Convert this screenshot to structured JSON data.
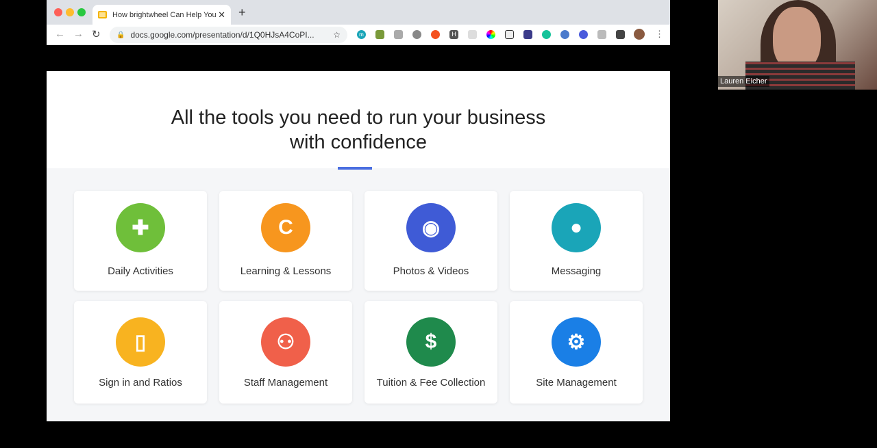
{
  "browser": {
    "tab_title": "How brightwheel Can Help You",
    "url": "docs.google.com/presentation/d/1Q0HJsA4CoPI...",
    "extension_letter_m": "m",
    "extension_letter_h": "H"
  },
  "slide": {
    "title_line1": "All the tools you need to run your business",
    "title_line2": "with confidence",
    "accent": "#4a6ee0",
    "cards": [
      {
        "label": "Daily Activities",
        "icon": "puzzle-icon",
        "color": "#6fbf3a",
        "glyph": "✚"
      },
      {
        "label": "Learning & Lessons",
        "icon": "blocks-icon",
        "color": "#f7961e",
        "glyph": "C"
      },
      {
        "label": "Photos & Videos",
        "icon": "camera-icon",
        "color": "#3f5bd6",
        "glyph": "◉"
      },
      {
        "label": "Messaging",
        "icon": "chat-bubble-icon",
        "color": "#1aa5b8",
        "glyph": "●"
      },
      {
        "label": "Sign  in and Ratios",
        "icon": "door-check-icon",
        "color": "#f8b320",
        "glyph": "▯"
      },
      {
        "label": "Staff Management",
        "icon": "group-icon",
        "color": "#f0604a",
        "glyph": "⚇"
      },
      {
        "label": "Tuition & Fee Collection",
        "icon": "dollar-icon",
        "color": "#1f8a4c",
        "glyph": "$"
      },
      {
        "label": "Site Management",
        "icon": "gear-icon",
        "color": "#1a7fe6",
        "glyph": "⚙"
      }
    ]
  },
  "webcam": {
    "participant_name": "Lauren Eicher"
  }
}
